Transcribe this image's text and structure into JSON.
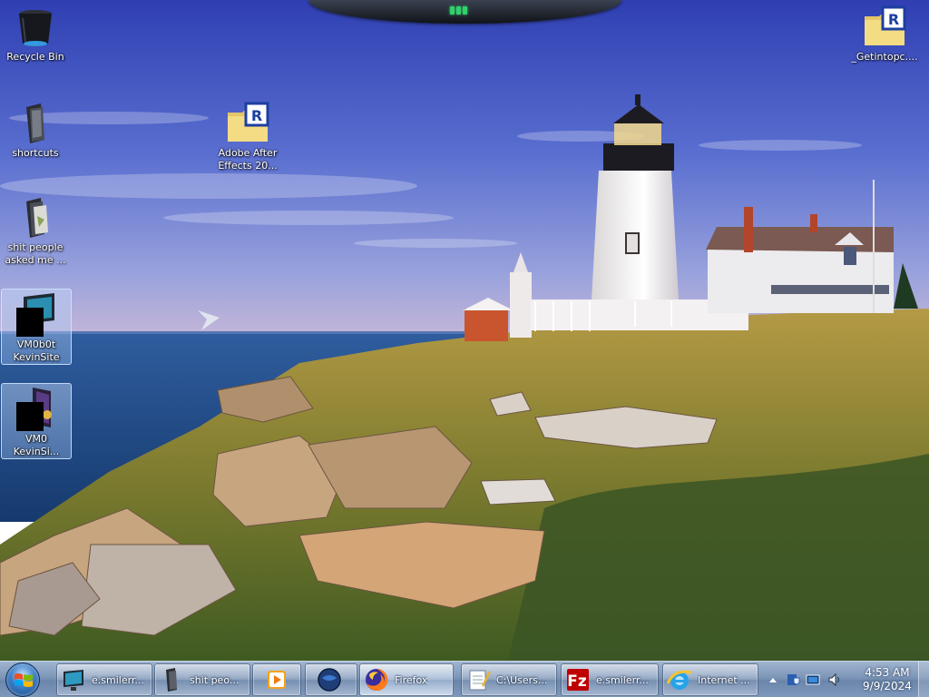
{
  "desktop": {
    "icons": [
      {
        "label": "Recycle Bin",
        "icon": "recycle-bin-icon"
      },
      {
        "label": "shortcuts",
        "icon": "folder-icon"
      },
      {
        "label": "shit people asked me ...",
        "icon": "folder-icon"
      },
      {
        "label": "VM0b0t KevinSite",
        "icon": "shortcut-icon"
      },
      {
        "label": "VM0 KevinSi...",
        "icon": "shortcut-icon"
      },
      {
        "label": "Adobe After Effects 20...",
        "icon": "winrar-archive-icon"
      },
      {
        "label": "_Getintopc....",
        "icon": "winrar-archive-icon"
      }
    ]
  },
  "taskbar": {
    "start": {
      "icon": "windows-start-orb-icon"
    },
    "buttons": [
      {
        "label": "e.smilerr...",
        "icon": "monitor-icon"
      },
      {
        "label": "shit peo...",
        "icon": "folder-icon"
      },
      {
        "label": "",
        "icon": "media-player-icon"
      },
      {
        "label": "",
        "icon": "globe-icon"
      },
      {
        "label": "Firefox",
        "icon": "firefox-icon"
      },
      {
        "label": "C:\\Users...",
        "icon": "notepad-icon"
      },
      {
        "label": "e.smilerr...",
        "icon": "filezilla-icon"
      },
      {
        "label": "Internet ...",
        "icon": "internet-explorer-icon"
      }
    ],
    "tray": {
      "icons": [
        "show-hidden-icons-arrow",
        "network-shield-icon",
        "action-center-icon",
        "monitor-icon",
        "volume-icon"
      ],
      "time": "4:53 AM",
      "date": "9/9/2024"
    }
  },
  "colors": {
    "taskbar": "#7d96b8",
    "sky_top": "#3a4fb8",
    "sea": "#24508d"
  }
}
